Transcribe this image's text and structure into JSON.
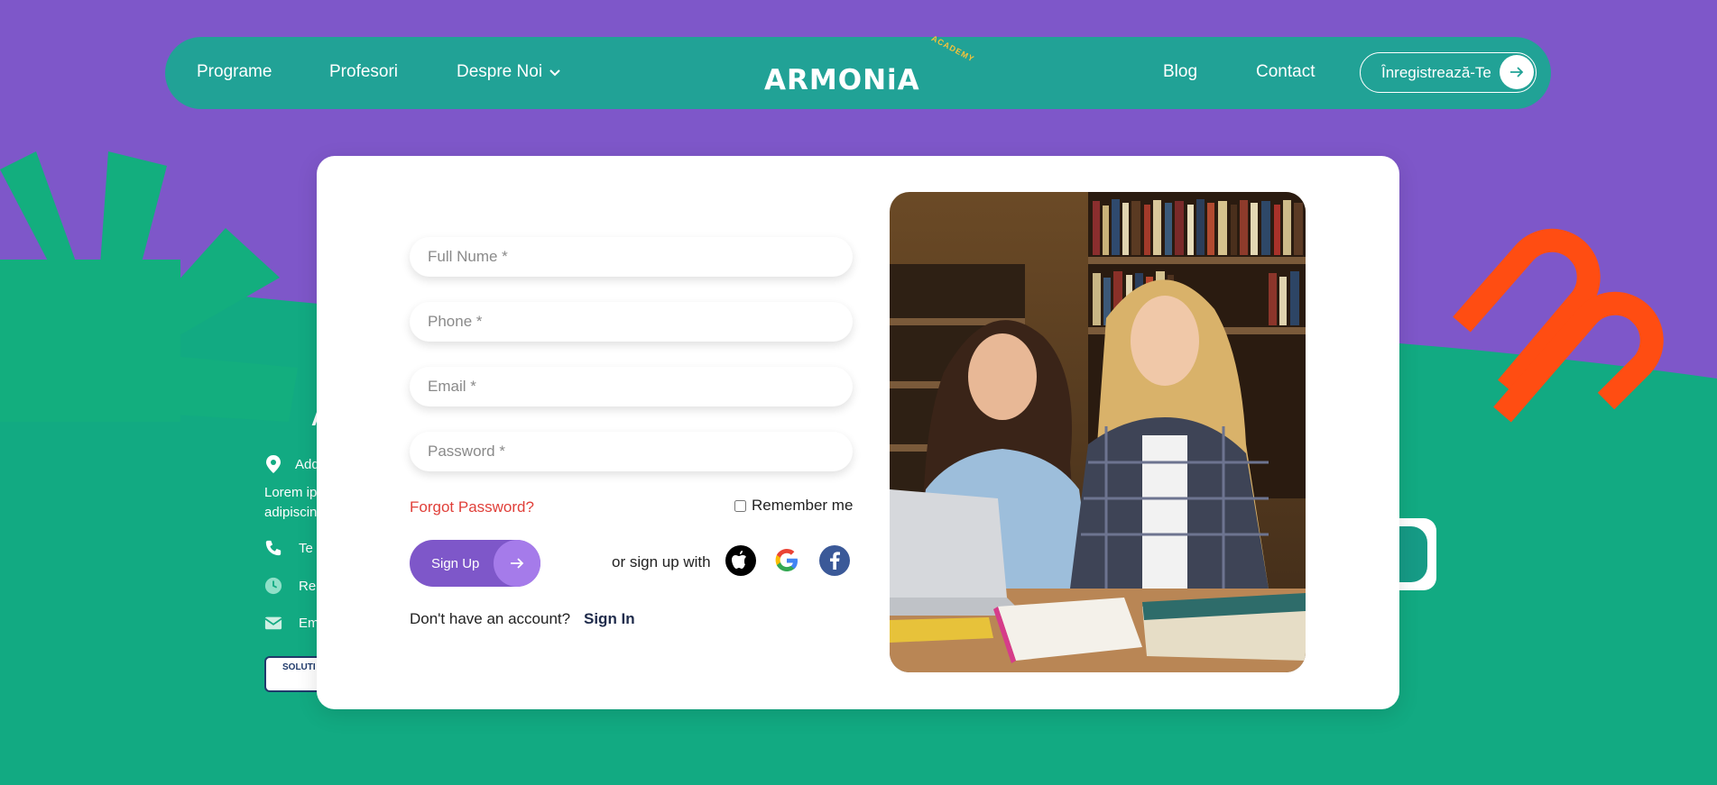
{
  "colors": {
    "purple": "#7E57C9",
    "green": "#12AA82",
    "nav_teal": "#21A296",
    "orange": "#FF4D12",
    "forgot_red": "#E0403A"
  },
  "nav": {
    "left_links": [
      {
        "label": "Programe"
      },
      {
        "label": "Profesori"
      },
      {
        "label": "Despre Noi",
        "icon": "chevron-down-icon"
      }
    ],
    "right_links": [
      {
        "label": "Blog"
      },
      {
        "label": "Contact"
      }
    ],
    "logo": {
      "text": "ARMONiA",
      "sub": "ACADEMY"
    },
    "cta": {
      "label": "Înregistrează-Te",
      "icon": "arrow-right-icon"
    }
  },
  "footer": {
    "address_label": "Add",
    "lorem": "Lorem ip adipiscin",
    "phone_label": "Te",
    "schedule_label": "Re",
    "email_label": "Em",
    "badge_text": "SOLUTI A"
  },
  "form": {
    "fields": {
      "full_name_placeholder": "Full Nume *",
      "phone_placeholder": "Phone *",
      "email_placeholder": "Email *",
      "password_placeholder": "Password *"
    },
    "forgot_label": "Forgot Password?",
    "remember_label": "Remember me",
    "remember_checked": false,
    "signup_label": "Sign Up",
    "or_text": "or sign up with",
    "social": [
      "apple-icon",
      "google-icon",
      "facebook-icon"
    ],
    "account_text": "Don't have an account?",
    "signin_label": "Sign In"
  }
}
